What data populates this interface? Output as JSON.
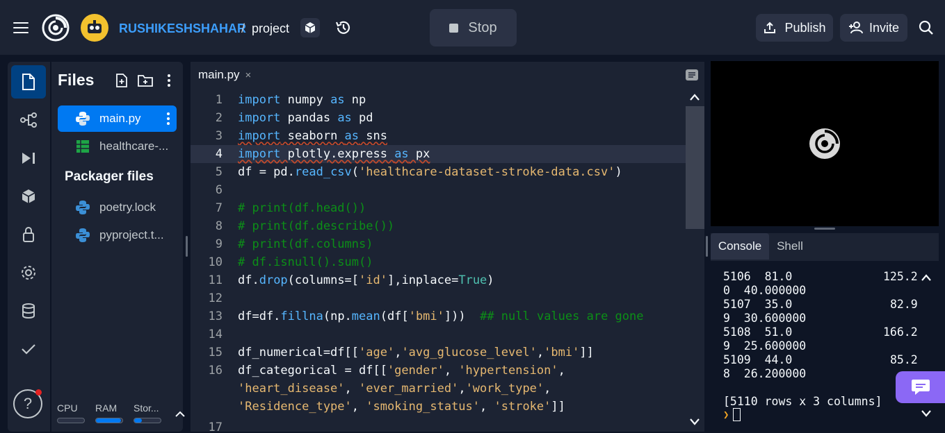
{
  "header": {
    "owner": "RUSHIKESHSHAHAR",
    "separator": "/",
    "project": "project",
    "stop_label": "Stop",
    "publish_label": "Publish",
    "invite_label": "Invite"
  },
  "sidebar": {
    "items": [
      "files-icon",
      "git-branch-icon",
      "debugger-icon",
      "packages-icon",
      "secrets-lock-icon",
      "settings-gear-icon",
      "database-icon",
      "check-icon"
    ],
    "help": "?"
  },
  "files": {
    "title": "Files",
    "items": [
      {
        "name": "main.py",
        "icon": "python-icon",
        "active": true
      },
      {
        "name": "healthcare-...",
        "icon": "spreadsheet-icon",
        "active": false
      }
    ],
    "packager_title": "Packager files",
    "packager_items": [
      {
        "name": "poetry.lock",
        "icon": "python-icon"
      },
      {
        "name": "pyproject.t...",
        "icon": "python-icon"
      }
    ],
    "resources": {
      "cpu_label": "CPU",
      "ram_label": "RAM",
      "storage_label": "Stor...",
      "cpu_level": 0.0,
      "ram_level": 0.95,
      "storage_level": 0.3
    }
  },
  "editor": {
    "tab_label": "main.py",
    "tab_close": "×",
    "line_numbers": [
      "1",
      "2",
      "3",
      "4",
      "5",
      "6",
      "7",
      "8",
      "9",
      "10",
      "11",
      "12",
      "13",
      "14",
      "15",
      "16",
      "17"
    ],
    "lines": {
      "l1": {
        "a": "import",
        "b": " numpy ",
        "c": "as",
        "d": " np"
      },
      "l2": {
        "a": "import",
        "b": " pandas ",
        "c": "as",
        "d": " pd"
      },
      "l3": {
        "a": "import",
        "b": " seaborn ",
        "c": "as",
        "d": " sns"
      },
      "l4": {
        "a": "import",
        "b": " plotly.express ",
        "c": "as",
        "d": " px"
      },
      "l5": {
        "a": "df = pd.",
        "b": "read_csv",
        "c": "(",
        "d": "'healthcare-dataset-stroke-data.csv'",
        "e": ")"
      },
      "l7": "# print(df.head())",
      "l8": "# print(df.describe())",
      "l9": "# print(df.columns)",
      "l10": "# df.isnull().sum()",
      "l11": {
        "a": "df.",
        "b": "drop",
        "c": "(columns=[",
        "d": "'id'",
        "e": "],inplace=",
        "f": "True",
        "g": ")"
      },
      "l13": {
        "a": "df=df.",
        "b": "fillna",
        "c": "(np.",
        "d": "mean",
        "e": "(df[",
        "f": "'bmi'",
        "g": "]))  ",
        "h": "## null values are gone"
      },
      "l15": {
        "a": "df_numerical=df[[",
        "b": "'age'",
        "c": ",",
        "d": "'avg_glucose_level'",
        "e": ",",
        "f": "'bmi'",
        "g": "]]"
      },
      "l16": {
        "a": "df_categorical = df[[",
        "b": "'gender'",
        "c": ", ",
        "d": "'hypertension'",
        "e": ","
      },
      "l16b": {
        "a": "'heart_disease'",
        "b": ", ",
        "c": "'ever_married'",
        "d": ",",
        "e": "'work_type'",
        "f": ","
      },
      "l16c": {
        "a": "'Residence_type'",
        "b": ", ",
        "c": "'smoking_status'",
        "d": ", ",
        "e": "'stroke'",
        "f": "]]"
      }
    }
  },
  "console": {
    "tabs": [
      "Console",
      "Shell"
    ],
    "rows": [
      {
        "left": "5106  81.0",
        "right": "125.2"
      },
      {
        "left": "0  40.000000",
        "right": ""
      },
      {
        "left": "5107  35.0",
        "right": "82.9"
      },
      {
        "left": "9  30.600000",
        "right": ""
      },
      {
        "left": "5108  51.0",
        "right": "166.2"
      },
      {
        "left": "9  25.600000",
        "right": ""
      },
      {
        "left": "5109  44.0",
        "right": "85.2"
      },
      {
        "left": "8  26.200000",
        "right": ""
      }
    ],
    "summary": "[5110 rows x 3 columns]"
  },
  "colors": {
    "accent": "#0079f2",
    "brand_link": "#3c9dfa",
    "chat_button": "#8b68f5"
  }
}
